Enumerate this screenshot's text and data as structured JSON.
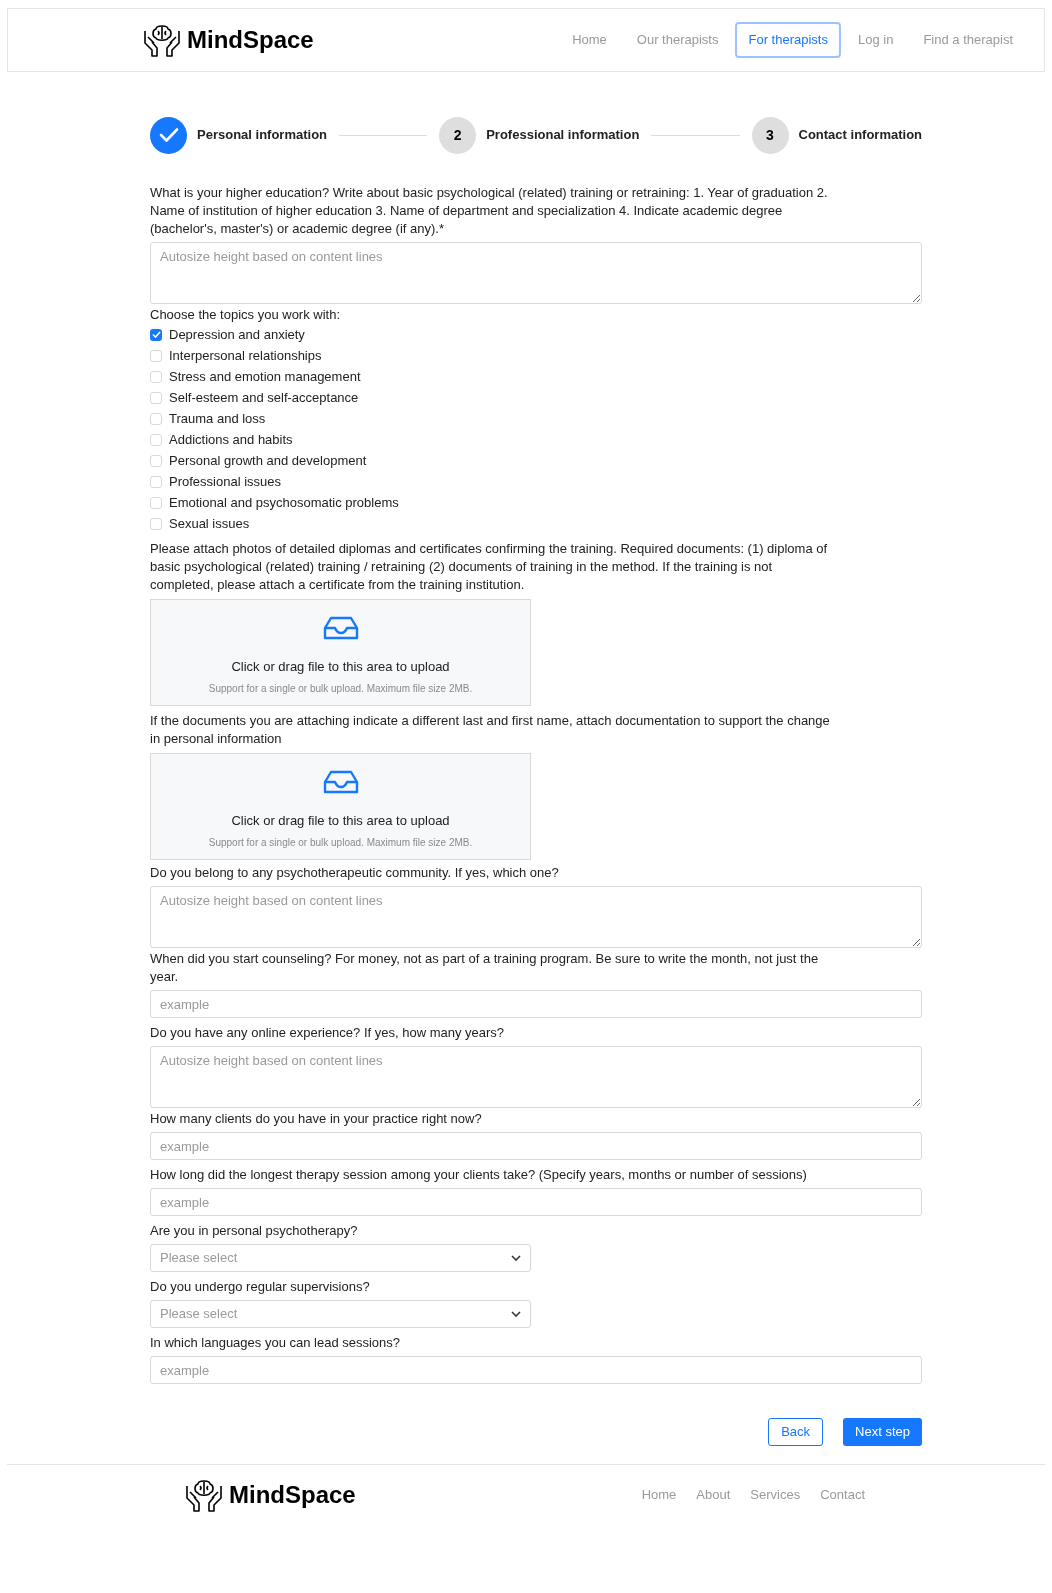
{
  "header": {
    "brand": "MindSpace",
    "nav": [
      {
        "label": "Home",
        "selected": false
      },
      {
        "label": "Our therapists",
        "selected": false
      },
      {
        "label": "For therapists",
        "selected": true
      },
      {
        "label": "Log in",
        "selected": false
      },
      {
        "label": "Find a therapist",
        "selected": false
      }
    ]
  },
  "steps": [
    {
      "label": "Personal information",
      "done": true
    },
    {
      "number": "2",
      "label": "Professional information",
      "done": false
    },
    {
      "number": "3",
      "label": "Contact information",
      "done": false
    }
  ],
  "fields": [
    {
      "kind": "textarea",
      "label": "What is your higher education? Write about basic psychological (related) training or retraining: 1. Year of graduation 2. Name of institution of higher education 3. Name of department and specialization 4. Indicate academic degree (bachelor's, master's) or academic degree (if any).*",
      "placeholder": "Autosize height based on content lines"
    },
    {
      "kind": "checkboxes",
      "label": "Choose the topics you work with:",
      "options": [
        {
          "label": "Depression and anxiety",
          "checked": true
        },
        {
          "label": "Interpersonal relationships",
          "checked": false
        },
        {
          "label": "Stress and emotion management",
          "checked": false
        },
        {
          "label": "Self-esteem and self-acceptance",
          "checked": false
        },
        {
          "label": "Trauma and loss",
          "checked": false
        },
        {
          "label": "Addictions and habits",
          "checked": false
        },
        {
          "label": "Personal growth and development",
          "checked": false
        },
        {
          "label": "Professional issues",
          "checked": false
        },
        {
          "label": "Emotional and psychosomatic problems",
          "checked": false
        },
        {
          "label": "Sexual issues",
          "checked": false
        }
      ]
    },
    {
      "kind": "upload",
      "label": "Please attach photos of detailed diplomas and certificates confirming the training. Required documents: (1) diploma of basic psychological (related) training / retraining (2) documents of training in the method. If the training is not completed, please attach a certificate from the training institution.",
      "title": "Click or drag file to this area to upload",
      "hint": "Support for a single or bulk upload. Maximum file size 2MB."
    },
    {
      "kind": "upload",
      "label": "If the documents you are attaching indicate a different last and first name, attach documentation to support the change in personal information",
      "title": "Click or drag file to this area to upload",
      "hint": "Support for a single or bulk upload. Maximum file size 2MB."
    },
    {
      "kind": "textarea",
      "label": "Do you belong to any psychotherapeutic community. If yes, which one?",
      "placeholder": "Autosize height based on content lines"
    },
    {
      "kind": "input",
      "label": "When did you start counseling? For money, not as part of a training program. Be sure to write the month, not just the year.",
      "placeholder": "example"
    },
    {
      "kind": "textarea",
      "label": "Do you have any online experience? If yes, how many years?",
      "placeholder": "Autosize height based on content lines"
    },
    {
      "kind": "input",
      "label": "How many clients do you have in your practice right now?",
      "placeholder": "example"
    },
    {
      "kind": "input",
      "label": "How long did the longest therapy session among your clients take? (Specify years, months or number of sessions)",
      "placeholder": "example"
    },
    {
      "kind": "select",
      "label": "Are you in personal psychotherapy?",
      "placeholder": "Please select"
    },
    {
      "kind": "select",
      "label": "Do you undergo regular supervisions?",
      "placeholder": "Please select"
    },
    {
      "kind": "input",
      "label": "In which languages you can lead sessions?",
      "placeholder": "example"
    }
  ],
  "buttons": {
    "back": "Back",
    "next": "Next step"
  },
  "footer": {
    "brand": "MindSpace",
    "links": [
      "Home",
      "About",
      "Services",
      "Contact"
    ]
  }
}
